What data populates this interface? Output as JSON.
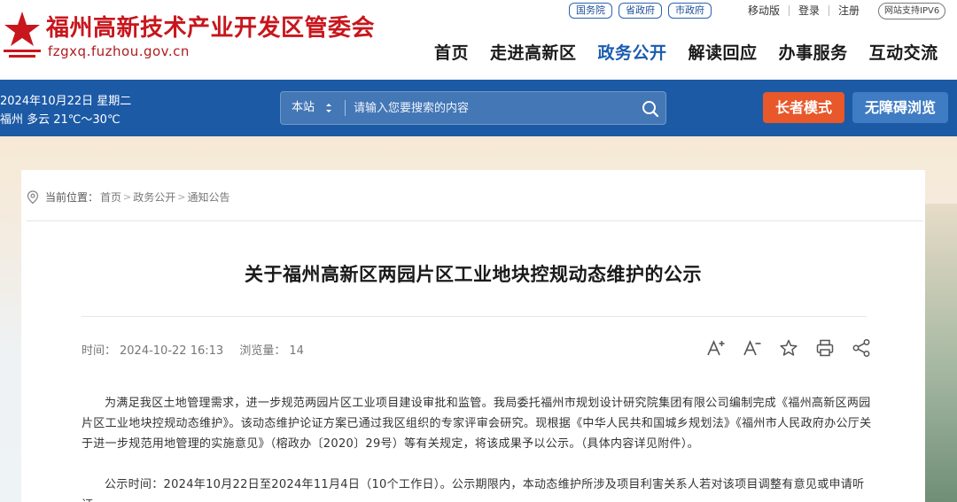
{
  "header": {
    "site_title": "福州高新技术产业开发区管委会",
    "site_domain": "fzgxq.fuzhou.gov.cn",
    "gov_links": [
      "国务院",
      "省政府",
      "市政府"
    ],
    "mobile": "移动版",
    "login": "登录",
    "register": "注册",
    "ipv6": "网站支持IPV6",
    "logo_color": "#c8161d"
  },
  "nav": {
    "items": [
      "首页",
      "走进高新区",
      "政务公开",
      "解读回应",
      "办事服务",
      "互动交流"
    ],
    "active": "政务公开"
  },
  "toolbar": {
    "date": "2024年10月22日 星期二",
    "weather": "福州 多云 21℃～30℃",
    "search_scope": "本站",
    "search_placeholder": "请输入您要搜索的内容",
    "elder_mode": "长者模式",
    "accessible": "无障碍浏览",
    "bar_color": "#1c5aa6",
    "elder_color": "#e8582a"
  },
  "breadcrumb": {
    "label": "当前位置：",
    "items": [
      "首页",
      "政务公开",
      "通知公告"
    ]
  },
  "article": {
    "title": "关于福州高新区两园片区工业地块控规动态维护的公示",
    "time_label": "时间：",
    "time": "2024-10-22 16:13",
    "views_label": "浏览量：",
    "views": "14",
    "tools": [
      "font-increase-icon",
      "font-decrease-icon",
      "star-icon",
      "print-icon",
      "share-icon"
    ],
    "paragraph1": "为满足我区土地管理需求，进一步规范两园片区工业项目建设审批和监管。我局委托福州市规划设计研究院集团有限公司编制完成《福州高新区两园片区工业地块控规动态维护》。该动态维护论证方案已通过我区组织的专家评审会研究。现根据《中华人民共和国城乡规划法》《福州市人民政府办公厅关于进一步规范用地管理的实施意见》（榕政办〔2020〕29号）等有关规定，将该成果予以公示。（具体内容详见附件）。",
    "paragraph2": "公示时间：2024年10月22日至2024年11月4日（10个工作日）。公示期限内，本动态维护所涉及项目利害关系人若对该项目调整有意见或申请听证，"
  }
}
